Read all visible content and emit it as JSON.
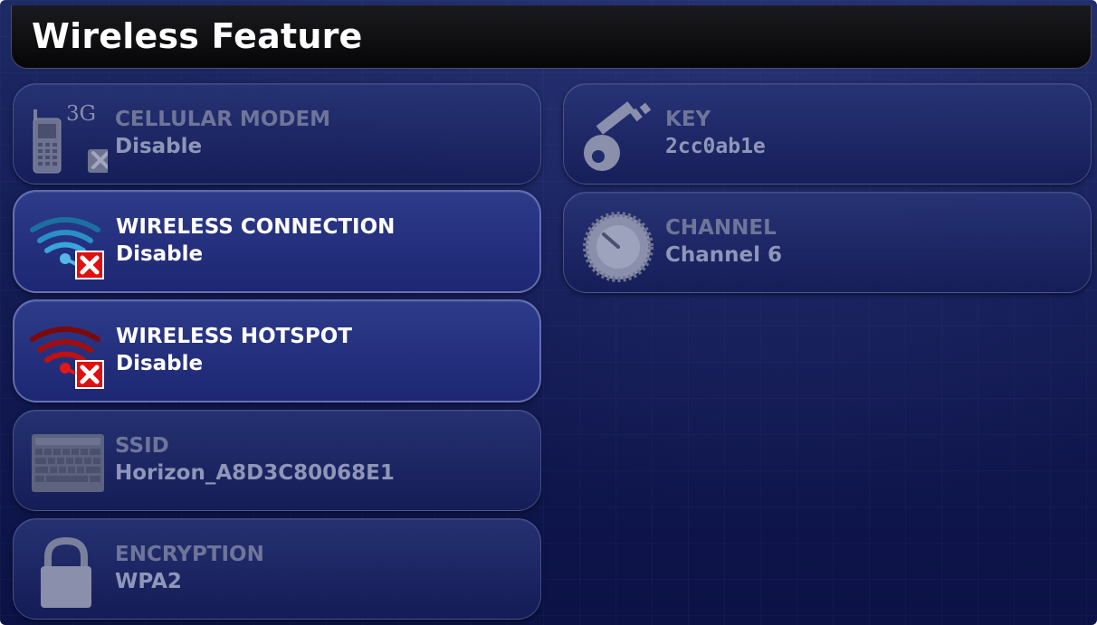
{
  "header": {
    "title": "Wireless Feature"
  },
  "left_column": [
    {
      "id": "cellular",
      "icon": "cellular-phone-icon",
      "icon_badge": "3G",
      "label": "CELLULAR MODEM",
      "value": "Disable",
      "enabled": false
    },
    {
      "id": "wireless-connection",
      "icon": "wifi-icon",
      "label": "WIRELESS CONNECTION",
      "value": "Disable",
      "enabled": true
    },
    {
      "id": "wireless-hotspot",
      "icon": "hotspot-icon",
      "label": "WIRELESS HOTSPOT",
      "value": "Disable",
      "enabled": true
    },
    {
      "id": "ssid",
      "icon": "keyboard-icon",
      "label": "SSID",
      "value": "Horizon_A8D3C80068E1",
      "enabled": false
    },
    {
      "id": "encryption",
      "icon": "padlock-icon",
      "label": "ENCRYPTION",
      "value": "WPA2",
      "enabled": false
    }
  ],
  "right_column": [
    {
      "id": "key",
      "icon": "key-icon",
      "label": "KEY",
      "value": "2cc0ab1e",
      "enabled": false
    },
    {
      "id": "channel",
      "icon": "dial-icon",
      "label": "CHANNEL",
      "value": "Channel 6",
      "enabled": false
    }
  ],
  "colors": {
    "background": "#141c55",
    "title_bar": "#060608",
    "active_text": "#ffffff",
    "disabled_text": "#6f7599",
    "wifi_blue": "#2a8fc9",
    "hotspot_red": "#c01010",
    "x_badge_red": "#e01010"
  }
}
